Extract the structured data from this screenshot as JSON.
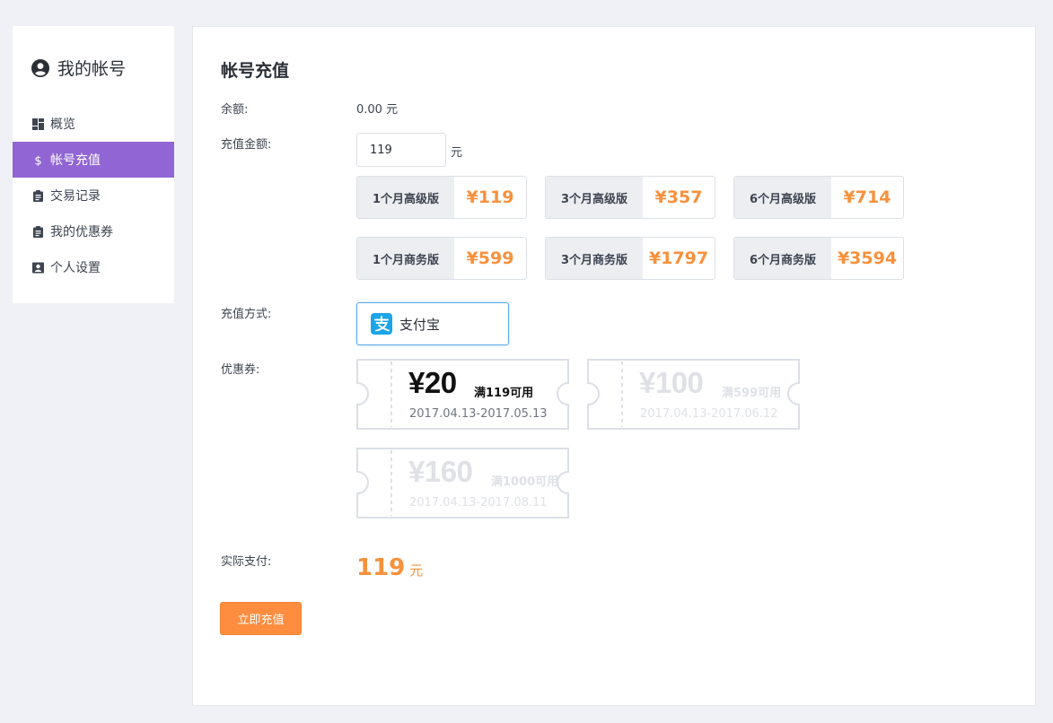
{
  "sidebar": {
    "title": "我的帐号",
    "items": [
      {
        "label": "概览",
        "icon": "dashboard-icon"
      },
      {
        "label": "帐号充值",
        "icon": "dollar-icon",
        "active": true
      },
      {
        "label": "交易记录",
        "icon": "clipboard-icon"
      },
      {
        "label": "我的优惠券",
        "icon": "clipboard-icon"
      },
      {
        "label": "个人设置",
        "icon": "user-card-icon"
      }
    ]
  },
  "main": {
    "title": "帐号充值",
    "balance": {
      "label": "余额:",
      "value": "0.00 元"
    },
    "amount": {
      "label": "充值金额:",
      "value": "119",
      "unit": "元"
    },
    "plans": [
      {
        "name": "1个月高级版",
        "price": "¥119"
      },
      {
        "name": "3个月高级版",
        "price": "¥357"
      },
      {
        "name": "6个月高级版",
        "price": "¥714"
      },
      {
        "name": "1个月商务版",
        "price": "¥599"
      },
      {
        "name": "3个月商务版",
        "price": "¥1797"
      },
      {
        "name": "6个月商务版",
        "price": "¥3594"
      }
    ],
    "payment": {
      "label": "充值方式:",
      "option": "支付宝"
    },
    "coupons": {
      "label": "优惠券:",
      "items": [
        {
          "amount": "¥20",
          "condition": "满119可用",
          "dates": "2017.04.13-2017.05.13",
          "enabled": true
        },
        {
          "amount": "¥100",
          "condition": "满599可用",
          "dates": "2017.04.13-2017.06.12",
          "enabled": false
        },
        {
          "amount": "¥160",
          "condition": "满1000可用",
          "dates": "2017.04.13-2017.08.11",
          "enabled": false
        }
      ]
    },
    "total": {
      "label": "实际支付:",
      "value": "119",
      "unit": "元"
    },
    "submit_label": "立即充值"
  },
  "colors": {
    "accent": "#9166d4",
    "price": "#f7913d",
    "button": "#ff8d3f",
    "alipay": "#1aa5e8"
  }
}
